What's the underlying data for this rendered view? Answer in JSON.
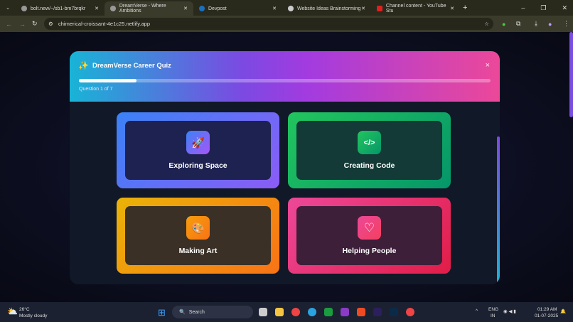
{
  "browser": {
    "tabs": [
      {
        "title": "bolt.new/~/sb1-bm7brqkr"
      },
      {
        "title": "DreamVerse - Where Ambitions",
        "active": true
      },
      {
        "title": "Devpost"
      },
      {
        "title": "Website Ideas Brainstorming"
      },
      {
        "title": "Channel content - YouTube Stu"
      }
    ],
    "new_tab": "+",
    "url": "chimerical-croissant-4e1c25.netlify.app"
  },
  "quiz": {
    "title": "DreamVerse Career Quiz",
    "close": "×",
    "question": "Question 1 of 7",
    "progress_percent": 14,
    "options": [
      {
        "label": "Exploring Space",
        "icon": "rocket-icon",
        "glyph": "🚀"
      },
      {
        "label": "Creating Code",
        "icon": "code-icon",
        "glyph": "</>"
      },
      {
        "label": "Making Art",
        "icon": "palette-icon",
        "glyph": "🎨"
      },
      {
        "label": "Helping People",
        "icon": "heart-icon",
        "glyph": "♡"
      }
    ]
  },
  "taskbar": {
    "temp": "26°C",
    "weather": "Mostly cloudy",
    "search": "Search",
    "lang": "ENG",
    "region": "IN",
    "time": "01:29 AM",
    "date": "01-07-2025"
  }
}
